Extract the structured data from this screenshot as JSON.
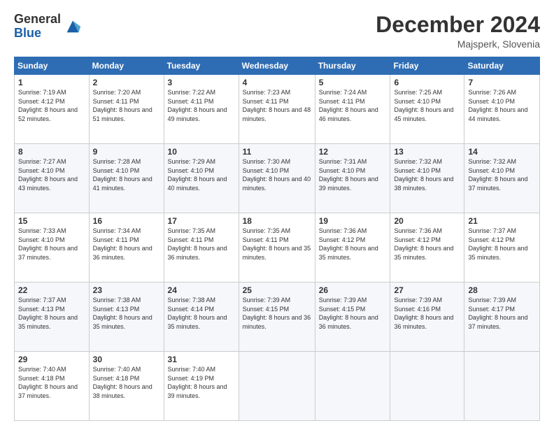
{
  "header": {
    "logo_line1": "General",
    "logo_line2": "Blue",
    "month_title": "December 2024",
    "location": "Majsperk, Slovenia"
  },
  "weekdays": [
    "Sunday",
    "Monday",
    "Tuesday",
    "Wednesday",
    "Thursday",
    "Friday",
    "Saturday"
  ],
  "weeks": [
    [
      {
        "day": "1",
        "sunrise": "7:19 AM",
        "sunset": "4:12 PM",
        "daylight": "8 hours and 52 minutes."
      },
      {
        "day": "2",
        "sunrise": "7:20 AM",
        "sunset": "4:11 PM",
        "daylight": "8 hours and 51 minutes."
      },
      {
        "day": "3",
        "sunrise": "7:22 AM",
        "sunset": "4:11 PM",
        "daylight": "8 hours and 49 minutes."
      },
      {
        "day": "4",
        "sunrise": "7:23 AM",
        "sunset": "4:11 PM",
        "daylight": "8 hours and 48 minutes."
      },
      {
        "day": "5",
        "sunrise": "7:24 AM",
        "sunset": "4:11 PM",
        "daylight": "8 hours and 46 minutes."
      },
      {
        "day": "6",
        "sunrise": "7:25 AM",
        "sunset": "4:10 PM",
        "daylight": "8 hours and 45 minutes."
      },
      {
        "day": "7",
        "sunrise": "7:26 AM",
        "sunset": "4:10 PM",
        "daylight": "8 hours and 44 minutes."
      }
    ],
    [
      {
        "day": "8",
        "sunrise": "7:27 AM",
        "sunset": "4:10 PM",
        "daylight": "8 hours and 43 minutes."
      },
      {
        "day": "9",
        "sunrise": "7:28 AM",
        "sunset": "4:10 PM",
        "daylight": "8 hours and 41 minutes."
      },
      {
        "day": "10",
        "sunrise": "7:29 AM",
        "sunset": "4:10 PM",
        "daylight": "8 hours and 40 minutes."
      },
      {
        "day": "11",
        "sunrise": "7:30 AM",
        "sunset": "4:10 PM",
        "daylight": "8 hours and 40 minutes."
      },
      {
        "day": "12",
        "sunrise": "7:31 AM",
        "sunset": "4:10 PM",
        "daylight": "8 hours and 39 minutes."
      },
      {
        "day": "13",
        "sunrise": "7:32 AM",
        "sunset": "4:10 PM",
        "daylight": "8 hours and 38 minutes."
      },
      {
        "day": "14",
        "sunrise": "7:32 AM",
        "sunset": "4:10 PM",
        "daylight": "8 hours and 37 minutes."
      }
    ],
    [
      {
        "day": "15",
        "sunrise": "7:33 AM",
        "sunset": "4:10 PM",
        "daylight": "8 hours and 37 minutes."
      },
      {
        "day": "16",
        "sunrise": "7:34 AM",
        "sunset": "4:11 PM",
        "daylight": "8 hours and 36 minutes."
      },
      {
        "day": "17",
        "sunrise": "7:35 AM",
        "sunset": "4:11 PM",
        "daylight": "8 hours and 36 minutes."
      },
      {
        "day": "18",
        "sunrise": "7:35 AM",
        "sunset": "4:11 PM",
        "daylight": "8 hours and 35 minutes."
      },
      {
        "day": "19",
        "sunrise": "7:36 AM",
        "sunset": "4:12 PM",
        "daylight": "8 hours and 35 minutes."
      },
      {
        "day": "20",
        "sunrise": "7:36 AM",
        "sunset": "4:12 PM",
        "daylight": "8 hours and 35 minutes."
      },
      {
        "day": "21",
        "sunrise": "7:37 AM",
        "sunset": "4:12 PM",
        "daylight": "8 hours and 35 minutes."
      }
    ],
    [
      {
        "day": "22",
        "sunrise": "7:37 AM",
        "sunset": "4:13 PM",
        "daylight": "8 hours and 35 minutes."
      },
      {
        "day": "23",
        "sunrise": "7:38 AM",
        "sunset": "4:13 PM",
        "daylight": "8 hours and 35 minutes."
      },
      {
        "day": "24",
        "sunrise": "7:38 AM",
        "sunset": "4:14 PM",
        "daylight": "8 hours and 35 minutes."
      },
      {
        "day": "25",
        "sunrise": "7:39 AM",
        "sunset": "4:15 PM",
        "daylight": "8 hours and 36 minutes."
      },
      {
        "day": "26",
        "sunrise": "7:39 AM",
        "sunset": "4:15 PM",
        "daylight": "8 hours and 36 minutes."
      },
      {
        "day": "27",
        "sunrise": "7:39 AM",
        "sunset": "4:16 PM",
        "daylight": "8 hours and 36 minutes."
      },
      {
        "day": "28",
        "sunrise": "7:39 AM",
        "sunset": "4:17 PM",
        "daylight": "8 hours and 37 minutes."
      }
    ],
    [
      {
        "day": "29",
        "sunrise": "7:40 AM",
        "sunset": "4:18 PM",
        "daylight": "8 hours and 37 minutes."
      },
      {
        "day": "30",
        "sunrise": "7:40 AM",
        "sunset": "4:18 PM",
        "daylight": "8 hours and 38 minutes."
      },
      {
        "day": "31",
        "sunrise": "7:40 AM",
        "sunset": "4:19 PM",
        "daylight": "8 hours and 39 minutes."
      },
      null,
      null,
      null,
      null
    ]
  ]
}
